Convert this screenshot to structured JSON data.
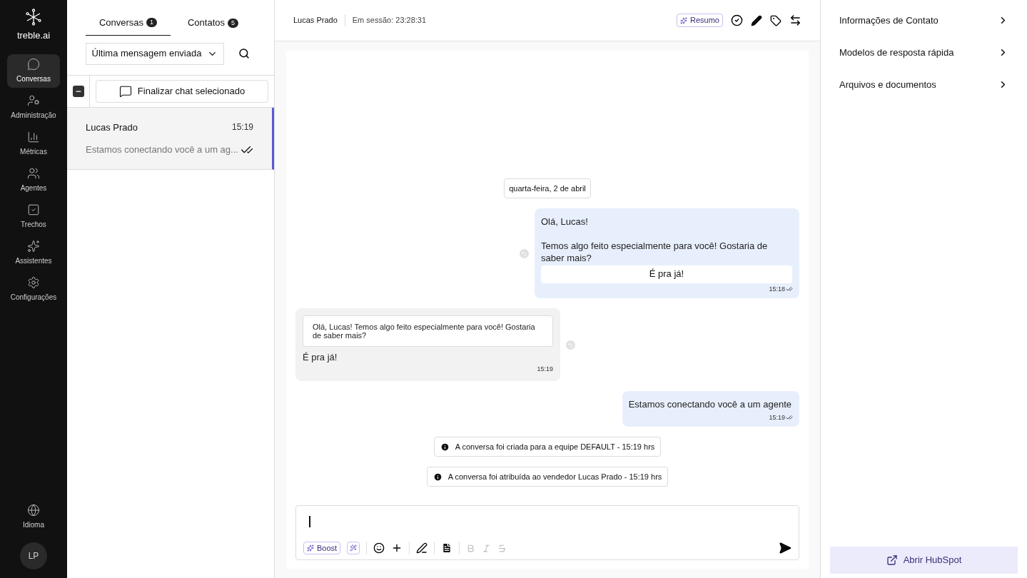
{
  "brand": {
    "name": "treble.ai"
  },
  "nav": [
    {
      "label": "Conversas",
      "selected": true
    },
    {
      "label": "Administração",
      "selected": false
    },
    {
      "label": "Métricas",
      "selected": false
    },
    {
      "label": "Agentes",
      "selected": false
    },
    {
      "label": "Trechos",
      "selected": false
    },
    {
      "label": "Assistentes",
      "selected": false
    },
    {
      "label": "Configurações",
      "selected": false
    }
  ],
  "nav_bottom": {
    "label": "Idioma",
    "avatar": "LP"
  },
  "list_tabs": [
    {
      "label": "Conversas",
      "count": "1",
      "selected": true
    },
    {
      "label": "Contatos",
      "count": "5",
      "selected": false
    }
  ],
  "sort": {
    "value": "Última mensagem enviada"
  },
  "select_all": {
    "indeterminate": true
  },
  "finish_button": "Finalizar chat selecionado",
  "conversations": [
    {
      "name": "Lucas Prado",
      "time": "15:19",
      "preview": "Estamos conectando você a um ag...",
      "selected": true,
      "read": true
    }
  ],
  "chat_header": {
    "name": "Lucas Prado",
    "session": "Em sessão: 23:28:31",
    "summary_button": "Resumo"
  },
  "messages": [
    {
      "kind": "date",
      "text": "quarta-feira, 2 de abril"
    },
    {
      "kind": "outgoing",
      "lines": [
        "Olá, Lucas!",
        "Temos algo feito especialmente para você! Gostaria de saber mais?"
      ],
      "button": "É pra já!",
      "time": "15:18",
      "read": true
    },
    {
      "kind": "incoming",
      "quote": "Olá, Lucas! Temos algo feito especialmente para você! Gostaria de saber mais?",
      "text": "É pra já!",
      "time": "15:19"
    },
    {
      "kind": "outgoing",
      "lines": [
        "Estamos conectando você a um agente"
      ],
      "time": "15:19",
      "read": true
    },
    {
      "kind": "notice",
      "text": "A conversa foi criada para a equipe DEFAULT - 15:19 hrs"
    },
    {
      "kind": "notice",
      "text": "A conversa foi atribuída ao vendedor Lucas Prado - 15:19 hrs"
    }
  ],
  "composer": {
    "boost_button": "Boost"
  },
  "side_sections": [
    "Informações de Contato",
    "Modelos de resposta rápida",
    "Arquivos e documentos"
  ],
  "hubspot_button": "Abrir HubSpot"
}
